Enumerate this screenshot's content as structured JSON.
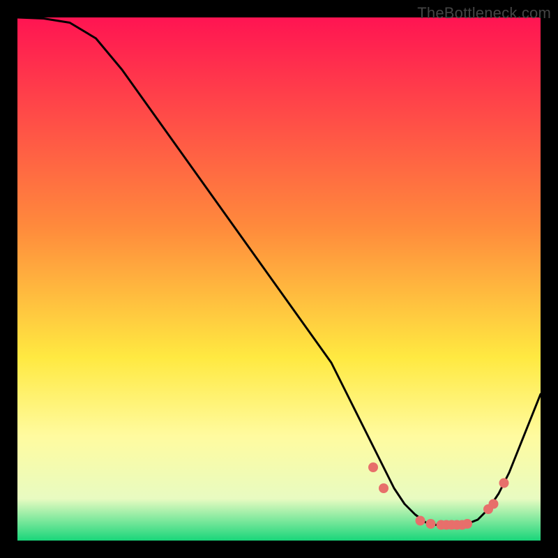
{
  "watermark": "TheBottleneck.com",
  "colors": {
    "black": "#000000",
    "line": "#000000",
    "marker": "#e76f6b",
    "grad_top": "#ff1452",
    "grad_mid_orange": "#ff8a3c",
    "grad_yellow": "#ffe941",
    "grad_light_yellow": "#fffb9f",
    "grad_pale": "#e8fbc1",
    "grad_green": "#19d67a"
  },
  "chart_data": {
    "type": "line",
    "title": "",
    "xlabel": "",
    "ylabel": "",
    "xlim": [
      0,
      100
    ],
    "ylim": [
      0,
      100
    ],
    "series": [
      {
        "name": "bottleneck-curve",
        "x": [
          0,
          5,
          10,
          15,
          20,
          25,
          30,
          35,
          40,
          45,
          50,
          55,
          60,
          62,
          64,
          66,
          68,
          70,
          72,
          74,
          76,
          78,
          80,
          82,
          84,
          86,
          88,
          90,
          92,
          94,
          96,
          98,
          100
        ],
        "y": [
          100,
          99.8,
          99,
          96,
          90,
          83,
          76,
          69,
          62,
          55,
          48,
          41,
          34,
          30,
          26,
          22,
          18,
          14,
          10,
          7,
          5,
          3.5,
          3,
          3,
          3,
          3.2,
          4,
          6,
          9,
          13,
          18,
          23,
          28
        ]
      }
    ],
    "markers": {
      "name": "highlight-region",
      "x": [
        68,
        70,
        77,
        79,
        81,
        82,
        83,
        84,
        85,
        86,
        90,
        91,
        93
      ],
      "y": [
        14,
        10,
        3.8,
        3.2,
        3,
        3,
        3,
        3,
        3,
        3.2,
        6,
        7,
        11
      ]
    },
    "gradient_stops": [
      {
        "pos": 0.0,
        "color_key": "grad_top"
      },
      {
        "pos": 0.4,
        "color_key": "grad_mid_orange"
      },
      {
        "pos": 0.65,
        "color_key": "grad_yellow"
      },
      {
        "pos": 0.8,
        "color_key": "grad_light_yellow"
      },
      {
        "pos": 0.92,
        "color_key": "grad_pale"
      },
      {
        "pos": 1.0,
        "color_key": "grad_green"
      }
    ]
  }
}
